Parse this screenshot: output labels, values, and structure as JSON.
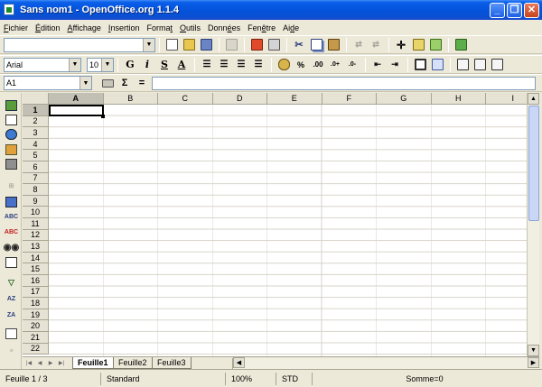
{
  "window": {
    "title": "Sans nom1 - OpenOffice.org 1.1.4"
  },
  "menu": [
    {
      "label": "Fichier",
      "accel": "F",
      "rest": "ichier",
      "pre": ""
    },
    {
      "label": "Édition",
      "accel": "É",
      "rest": "dition",
      "pre": ""
    },
    {
      "label": "Affichage",
      "accel": "A",
      "rest": "ffichage",
      "pre": ""
    },
    {
      "label": "Insertion",
      "accel": "I",
      "rest": "nsertion",
      "pre": ""
    },
    {
      "label": "Format",
      "pre": "Forma",
      "accel": "t",
      "rest": ""
    },
    {
      "label": "Outils",
      "accel": "O",
      "rest": "utils",
      "pre": ""
    },
    {
      "label": "Données",
      "pre": "Donn",
      "accel": "é",
      "rest": "es"
    },
    {
      "label": "Fenêtre",
      "pre": "Fen",
      "accel": "ê",
      "rest": "tre"
    },
    {
      "label": "Aide",
      "pre": "Ai",
      "accel": "d",
      "rest": "e"
    }
  ],
  "format_bar": {
    "font_name": "Arial",
    "font_size": "10",
    "bold_glyph": "G",
    "italic_glyph": "i",
    "underline_glyph": "S",
    "font_color_glyph": "A",
    "percent_glyph": "%"
  },
  "formula_bar": {
    "cell_ref": "A1",
    "sum_glyph": "Σ",
    "equals_glyph": "="
  },
  "sheet": {
    "columns": [
      "A",
      "B",
      "C",
      "D",
      "E",
      "F",
      "G",
      "H",
      "I"
    ],
    "rows": [
      "1",
      "2",
      "3",
      "4",
      "5",
      "6",
      "7",
      "8",
      "9",
      "10",
      "11",
      "12",
      "13",
      "14",
      "15",
      "16",
      "17",
      "18",
      "19",
      "20",
      "21",
      "22"
    ],
    "active_column": "A",
    "active_row": "1"
  },
  "tabs": [
    "Feuille1",
    "Feuille2",
    "Feuille3"
  ],
  "active_tab": "Feuille1",
  "status": {
    "sheet_pos": "Feuille 1 / 3",
    "style": "Standard",
    "zoom": "100%",
    "mode": "STD",
    "sum": "Somme=0"
  },
  "colors": {
    "title_blue": "#0453dc",
    "chrome": "#ece9d8"
  }
}
